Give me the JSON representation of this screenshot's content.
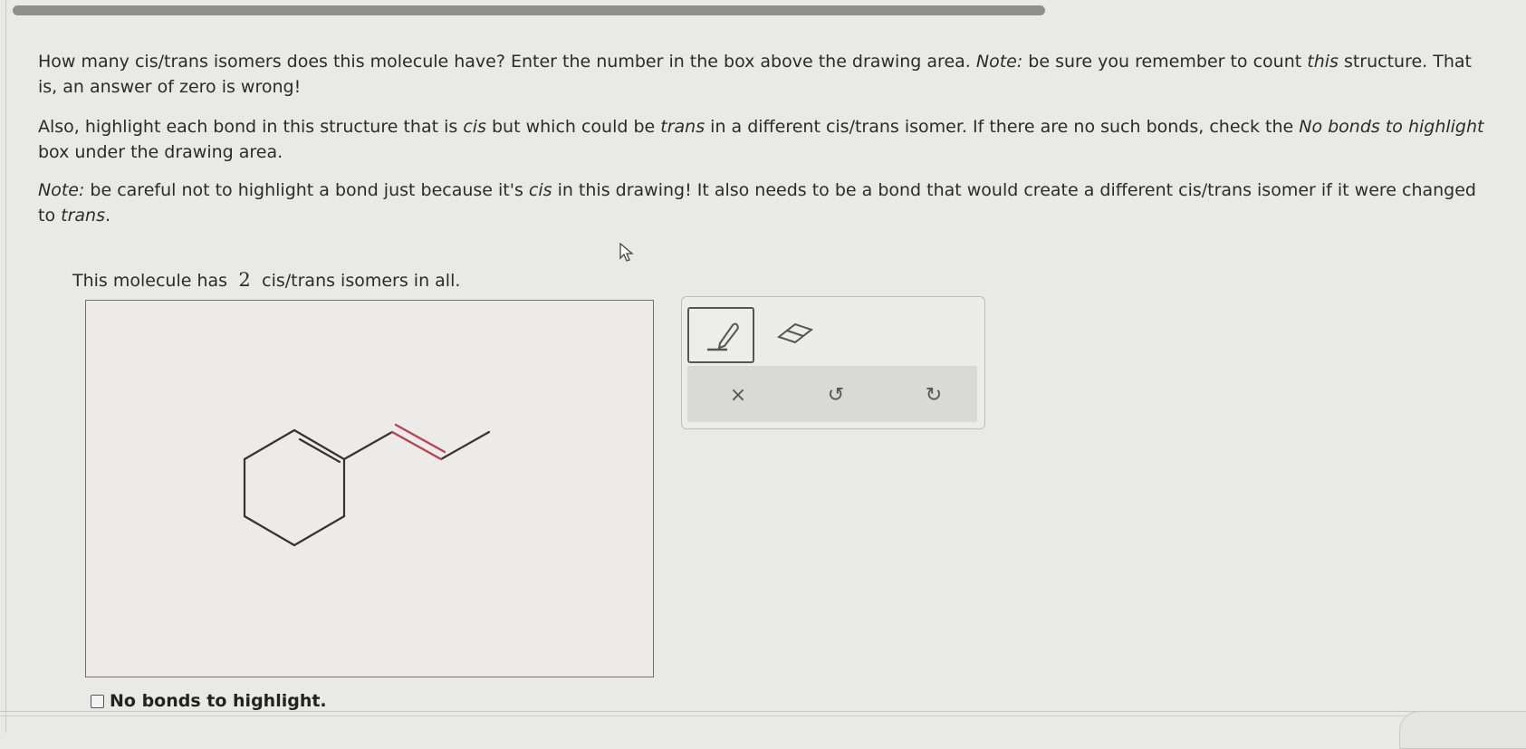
{
  "question": {
    "p1_a": "How many cis/trans isomers does this molecule have? Enter the number in the box above the drawing area. ",
    "p1_note": "Note:",
    "p1_b": " be sure you remember to count ",
    "p1_this": "this",
    "p1_c": " structure. That is, an answer of zero is wrong!",
    "p2_a": "Also, highlight each bond in this structure that is ",
    "p2_cis": "cis",
    "p2_b": " but which could be ",
    "p2_trans": "trans",
    "p2_c": " in a different cis/trans isomer. If there are no such bonds, check the ",
    "p2_nobonds": "No bonds to highlight",
    "p2_d": " box under the drawing area.",
    "p3_note": "Note:",
    "p3_a": " be careful not to highlight a bond just because it's ",
    "p3_cis": "cis",
    "p3_b": " in this drawing! It also needs to be a bond that would create a different cis/trans isomer if it were changed to ",
    "p3_trans": "trans",
    "p3_c": "."
  },
  "answer": {
    "prefix": "This molecule has",
    "value": "2",
    "suffix": "cis/trans isomers in all."
  },
  "toolbar": {
    "pencil_icon": "pencil-highlight-icon",
    "eraser_icon": "eraser-icon",
    "clear_icon": "x-icon",
    "undo_icon": "undo-icon",
    "redo_icon": "redo-icon",
    "clear_glyph": "×",
    "undo_glyph": "↺",
    "redo_glyph": "↻"
  },
  "checkbox": {
    "label": "No bonds to highlight.",
    "checked": false
  },
  "colors": {
    "highlight_bond": "#b8434f",
    "bond": "#333333"
  }
}
